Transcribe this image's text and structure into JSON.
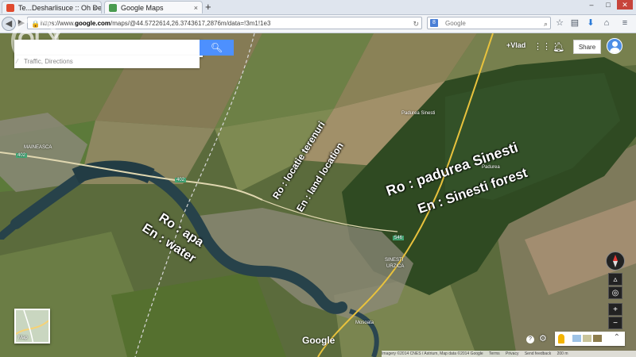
{
  "browser": {
    "tabs": [
      {
        "label": "Te...Desharlisuce :: Oh Dear..."
      },
      {
        "label": "Google Maps"
      }
    ],
    "new_tab": "+",
    "window_controls": [
      "–",
      "□",
      "✕"
    ],
    "url_prefix": "https://www.",
    "url_domain": "google.com",
    "url_rest": "/maps/@44.5722614,26.3743617,2876m/data=!3m1!1e3",
    "search_engine_badge": "8",
    "search_placeholder": "Google"
  },
  "map": {
    "search_placeholder": "",
    "search_icon": "search-icon",
    "traffic_link": "Traffic, Directions",
    "watermark": "OLX",
    "user_name": "+Vlad",
    "share_label": "Share",
    "overlays": {
      "forest_ro": "Ro : padurea Sinesti",
      "forest_en": "En : Sinesti forest",
      "land_ro": "Ro : locatie terenuri",
      "land_en": "En : land location",
      "water_ro": "Ro : apa",
      "water_en": "En : water"
    },
    "place_labels": {
      "forest": "Padurea Sinesti",
      "forest_short": "Padurea",
      "village_west": "MAINEASCA",
      "village_east": "SINESTI",
      "village_east_2": "URZICA",
      "south": "Mosoata",
      "road_402": "402",
      "road_402b": "402",
      "road_546": "546"
    },
    "minimap_label": "Map",
    "google_logo": "Google",
    "footer": {
      "imagery": "Imagery ©2014 CNES / Astrium, Map data ©2014 Google",
      "terms": "Terms",
      "privacy": "Privacy",
      "feedback": "Send feedback",
      "scale": "200 m"
    }
  }
}
